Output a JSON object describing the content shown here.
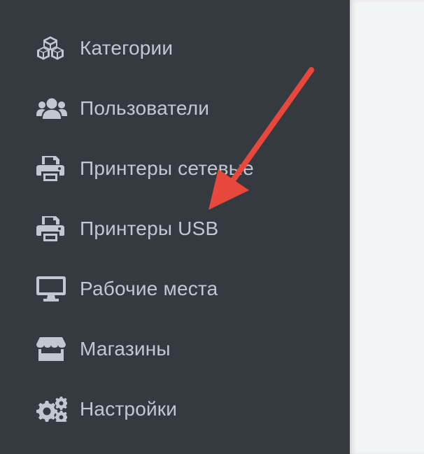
{
  "sidebar": {
    "items": [
      {
        "label": "Категории",
        "icon": "cubes-icon"
      },
      {
        "label": "Пользователи",
        "icon": "users-icon"
      },
      {
        "label": "Принтеры сетевые",
        "icon": "printer-icon"
      },
      {
        "label": "Принтеры USB",
        "icon": "printer-icon"
      },
      {
        "label": "Рабочие места",
        "icon": "desktop-icon"
      },
      {
        "label": "Магазины",
        "icon": "store-icon"
      },
      {
        "label": "Настройки",
        "icon": "cogs-icon"
      }
    ]
  },
  "annotation": {
    "arrow_color": "#e8473b"
  },
  "colors": {
    "sidebar_bg": "#343a40",
    "text": "#c2c7d0",
    "content_bg": "#f3f4f7"
  }
}
